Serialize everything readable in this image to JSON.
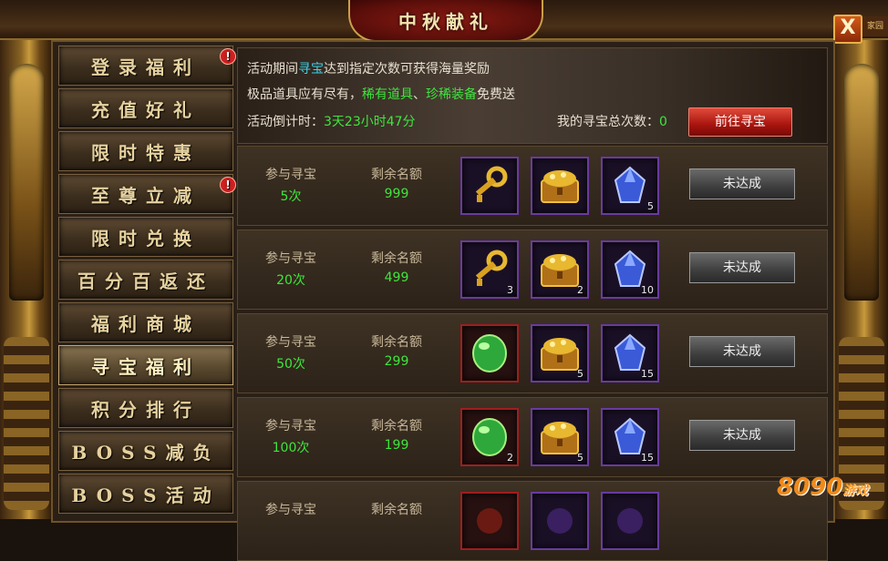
{
  "window": {
    "title": "中秋献礼",
    "close_label": "X",
    "corner_tag": "家园"
  },
  "sidebar": {
    "items": [
      {
        "label": "登录福利",
        "badge": "!",
        "active": false
      },
      {
        "label": "充值好礼",
        "badge": "",
        "active": false
      },
      {
        "label": "限时特惠",
        "badge": "",
        "active": false
      },
      {
        "label": "至尊立减",
        "badge": "!",
        "active": false
      },
      {
        "label": "限时兑换",
        "badge": "",
        "active": false
      },
      {
        "label": "百分百返还",
        "badge": "",
        "active": false
      },
      {
        "label": "福利商城",
        "badge": "",
        "active": false
      },
      {
        "label": "寻宝福利",
        "badge": "",
        "active": true
      },
      {
        "label": "积分排行",
        "badge": "",
        "active": false
      },
      {
        "label": "BOSS减负",
        "badge": "",
        "active": false
      },
      {
        "label": "BOSS活动",
        "badge": "",
        "active": false
      }
    ]
  },
  "info": {
    "line1_pre": "活动期间",
    "line1_hl": "寻宝",
    "line1_post": "达到指定次数可获得海量奖励",
    "line2_pre": "极品道具应有尽有，",
    "line2_hl1": "稀有道具",
    "line2_sep": "、",
    "line2_hl2": "珍稀装备",
    "line2_post": "免费送",
    "countdown_label": "活动倒计时：",
    "countdown_value": "3天23小时47分",
    "total_label": "我的寻宝总次数：",
    "total_value": "0",
    "go_button": "前往寻宝"
  },
  "rows": [
    {
      "join_label": "参与寻宝",
      "join_value": "5次",
      "remain_label": "剩余名额",
      "remain_value": "999",
      "items": [
        {
          "icon": "key-icon",
          "count": ""
        },
        {
          "icon": "treasure-chest-icon",
          "count": ""
        },
        {
          "icon": "blue-crystal-icon",
          "count": "5"
        }
      ],
      "status": "未达成"
    },
    {
      "join_label": "参与寻宝",
      "join_value": "20次",
      "remain_label": "剩余名额",
      "remain_value": "499",
      "items": [
        {
          "icon": "key-icon",
          "count": "3"
        },
        {
          "icon": "treasure-chest-icon",
          "count": "2"
        },
        {
          "icon": "blue-crystal-icon",
          "count": "10"
        }
      ],
      "status": "未达成"
    },
    {
      "join_label": "参与寻宝",
      "join_value": "50次",
      "remain_label": "剩余名额",
      "remain_value": "299",
      "items": [
        {
          "icon": "green-gem-icon",
          "count": ""
        },
        {
          "icon": "treasure-chest-icon",
          "count": "5"
        },
        {
          "icon": "blue-crystal-icon",
          "count": "15"
        }
      ],
      "status": "未达成"
    },
    {
      "join_label": "参与寻宝",
      "join_value": "100次",
      "remain_label": "剩余名额",
      "remain_value": "199",
      "items": [
        {
          "icon": "green-gem-icon",
          "count": "2"
        },
        {
          "icon": "treasure-chest-icon",
          "count": "5"
        },
        {
          "icon": "blue-crystal-icon",
          "count": "15"
        }
      ],
      "status": "未达成"
    },
    {
      "join_label": "参与寻宝",
      "join_value": "",
      "remain_label": "剩余名额",
      "remain_value": "",
      "items": [
        {
          "icon": "red-item-icon",
          "count": ""
        },
        {
          "icon": "purple-item-icon",
          "count": ""
        },
        {
          "icon": "purple-item-icon",
          "count": ""
        }
      ],
      "status": ""
    }
  ],
  "watermark": {
    "text": "8090",
    "suffix": "游戏"
  },
  "colors": {
    "highlight_green": "#3ee63e",
    "highlight_cyan": "#3ed0e6",
    "go_button": "#a8140e",
    "slot_purple": "#6a3aa0",
    "slot_red": "#a01e1e"
  }
}
